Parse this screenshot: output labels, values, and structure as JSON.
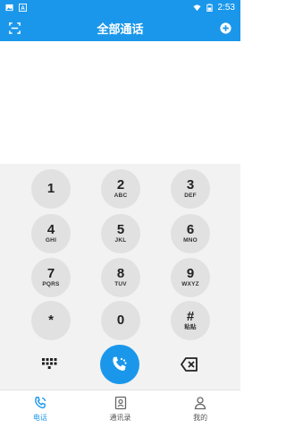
{
  "status_bar": {
    "time": "2:53",
    "icons": [
      "image-icon",
      "text-a-icon",
      "wifi-icon",
      "battery-icon"
    ]
  },
  "app_bar": {
    "title": "全部通话",
    "left_icon": "scan-icon",
    "right_icon": "add-circle-icon"
  },
  "dialpad": {
    "keys": [
      {
        "digit": "1",
        "letters": ""
      },
      {
        "digit": "2",
        "letters": "ABC"
      },
      {
        "digit": "3",
        "letters": "DEF"
      },
      {
        "digit": "4",
        "letters": "GHI"
      },
      {
        "digit": "5",
        "letters": "JKL"
      },
      {
        "digit": "6",
        "letters": "MNO"
      },
      {
        "digit": "7",
        "letters": "PQRS"
      },
      {
        "digit": "8",
        "letters": "TUV"
      },
      {
        "digit": "9",
        "letters": "WXYZ"
      },
      {
        "digit": "*",
        "letters": ""
      },
      {
        "digit": "0",
        "letters": ""
      },
      {
        "digit": "#",
        "letters": "粘贴"
      }
    ]
  },
  "controls": {
    "keypad_toggle_icon": "dialpad-grid-icon",
    "call_icon": "phone-call-icon",
    "delete_icon": "backspace-icon"
  },
  "tabs": [
    {
      "label": "电话",
      "icon": "phone-icon",
      "active": true
    },
    {
      "label": "通讯录",
      "icon": "contacts-icon",
      "active": false
    },
    {
      "label": "我的",
      "icon": "person-icon",
      "active": false
    }
  ],
  "colors": {
    "primary": "#1a97ea",
    "key_bg": "#e1e1e1",
    "pad_bg": "#f2f2f2"
  }
}
